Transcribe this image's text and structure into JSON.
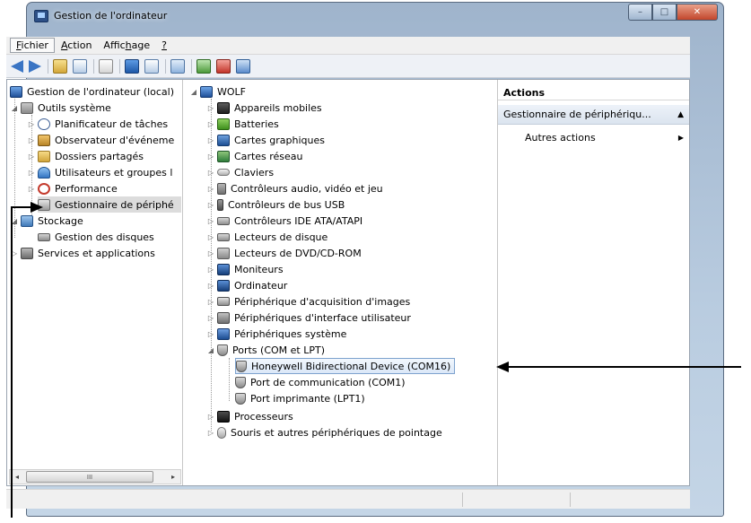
{
  "window": {
    "title": "Gestion de l'ordinateur",
    "caption_buttons": {
      "minimize": "–",
      "maximize": "□",
      "close": "✕"
    }
  },
  "menu": {
    "items": [
      {
        "pre": "",
        "u": "F",
        "post": "ichier"
      },
      {
        "pre": "",
        "u": "A",
        "post": "ction"
      },
      {
        "pre": "Affic",
        "u": "h",
        "post": "age"
      },
      {
        "pre": "",
        "u": "?",
        "post": ""
      }
    ]
  },
  "toolbar": {
    "icons": [
      "back-arrow-icon",
      "forward-arrow-icon",
      "up-folder-icon",
      "show-hide-tree-icon",
      "properties-icon",
      "help-icon",
      "console-tree-icon",
      "scan-hardware-icon",
      "update-driver-icon",
      "uninstall-icon",
      "enable-device-icon"
    ]
  },
  "left_tree": {
    "root": "Gestion de l'ordinateur (local)",
    "system_tools": "Outils système",
    "task_scheduler": "Planificateur de tâches",
    "event_viewer": "Observateur d'événeme",
    "shared_folders": "Dossiers partagés",
    "local_users": "Utilisateurs et groupes l",
    "performance": "Performance",
    "device_manager": "Gestionnaire de périphé",
    "storage": "Stockage",
    "disk_management": "Gestion des disques",
    "services": "Services et applications"
  },
  "device_tree": {
    "root": "WOLF",
    "categories": [
      "Appareils mobiles",
      "Batteries",
      "Cartes graphiques",
      "Cartes réseau",
      "Claviers",
      "Contrôleurs audio, vidéo et jeu",
      "Contrôleurs de bus USB",
      "Contrôleurs IDE ATA/ATAPI",
      "Lecteurs de disque",
      "Lecteurs de DVD/CD-ROM",
      "Moniteurs",
      "Ordinateur",
      "Périphérique d'acquisition d'images",
      "Périphériques d'interface utilisateur",
      "Périphériques système"
    ],
    "ports": "Ports (COM et LPT)",
    "port_children": [
      "Honeywell Bidirectional Device (COM16)",
      "Port de communication (COM1)",
      "Port imprimante (LPT1)"
    ],
    "after": [
      "Processeurs",
      "Souris et autres périphériques de pointage"
    ]
  },
  "actions": {
    "header": "Actions",
    "section": "Gestionnaire de périphériqu...",
    "other": "Autres actions"
  },
  "scrollbar": {
    "left_arrow": "◂",
    "right_arrow": "▸",
    "grip": "III"
  },
  "glyphs": {
    "expanded": "◢",
    "collapsed": "▷",
    "section_collapse": "▲",
    "submenu": "▶"
  }
}
